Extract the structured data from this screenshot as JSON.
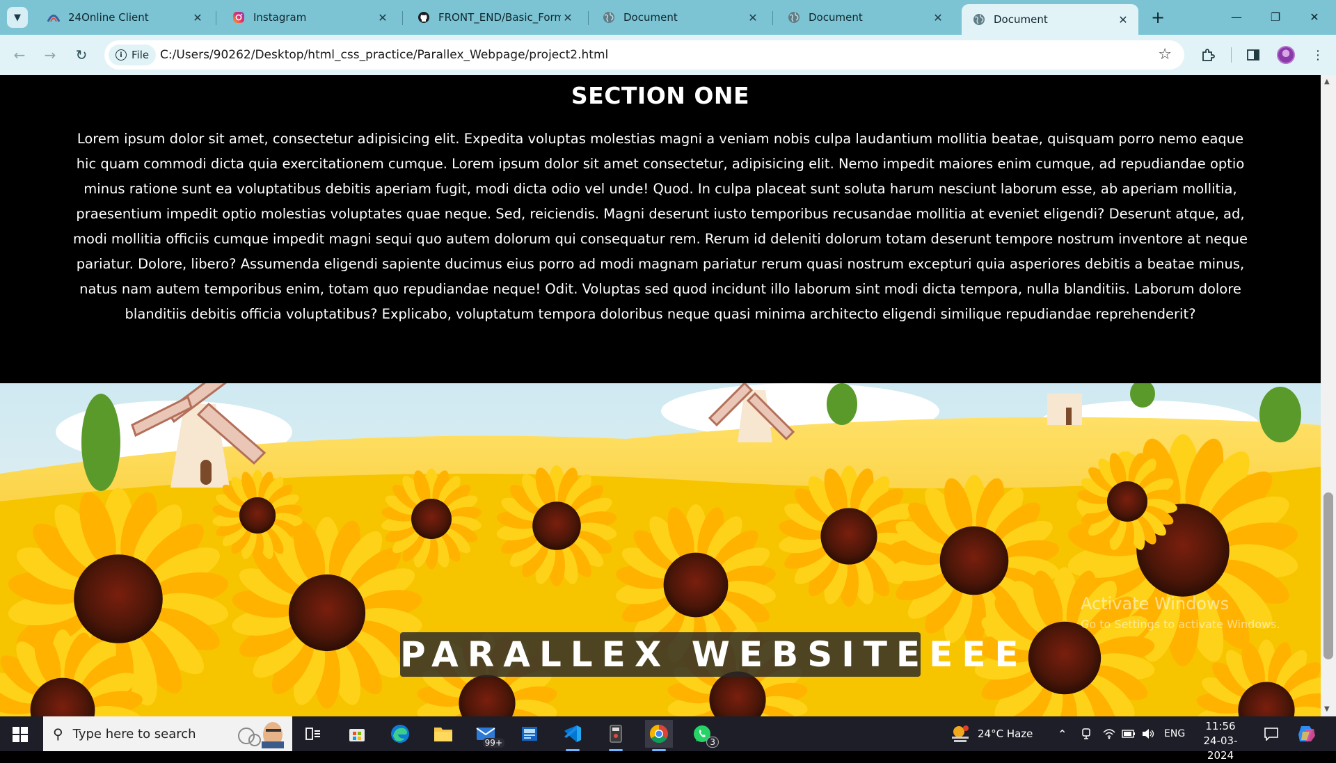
{
  "browser": {
    "tabs": [
      {
        "title": "24Online Client",
        "favicon": "24online-icon"
      },
      {
        "title": "Instagram",
        "favicon": "instagram-icon"
      },
      {
        "title": "FRONT_END/Basic_Form/",
        "favicon": "github-icon"
      },
      {
        "title": "Document",
        "favicon": "globe-icon"
      },
      {
        "title": "Document",
        "favicon": "globe-icon"
      },
      {
        "title": "Document",
        "favicon": "globe-icon",
        "active": true
      }
    ],
    "site_chip": "File",
    "url": "C:/Users/90262/Desktop/html_css_practice/Parallex_Webpage/project2.html"
  },
  "page": {
    "section_title": "SECTION ONE",
    "section_body": "Lorem ipsum dolor sit amet, consectetur adipisicing elit. Expedita voluptas molestias magni a veniam nobis culpa laudantium mollitia beatae, quisquam porro nemo eaque hic quam commodi dicta quia exercitationem cumque. Lorem ipsum dolor sit amet consectetur, adipisicing elit. Nemo impedit maiores enim cumque, ad repudiandae optio minus ratione sunt ea voluptatibus debitis aperiam fugit, modi dicta odio vel unde! Quod. In culpa placeat sunt soluta harum nesciunt laborum esse, ab aperiam mollitia, praesentium impedit optio molestias voluptates quae neque. Sed, reiciendis. Magni deserunt iusto temporibus recusandae mollitia at eveniet eligendi? Deserunt atque, ad, modi mollitia officiis cumque impedit magni sequi quo autem dolorum qui consequatur rem. Rerum id deleniti dolorum totam deserunt tempore nostrum inventore at neque pariatur. Dolore, libero? Assumenda eligendi sapiente ducimus eius porro ad modi magnam pariatur rerum quasi nostrum excepturi quia asperiores debitis a beatae minus, natus nam autem temporibus enim, totam quo repudiandae neque! Odit. Voluptas sed quod incidunt illo laborum sint modi dicta tempora, nulla blanditiis. Laborum dolore blanditiis debitis officia voluptatibus? Explicabo, voluptatum tempora doloribus neque quasi minima architecto eligendi similique repudiandae reprehenderit?",
    "hero_title": "PARALLEX WEBSITEEEE",
    "hero_image": "sunflower-field-with-windmills",
    "watermark_line1": "Activate Windows",
    "watermark_line2": "Go to Settings to activate Windows."
  },
  "taskbar": {
    "search_placeholder": "Type here to search",
    "mail_badge": "99+",
    "whatsapp_badge": "3",
    "weather": "24°C  Haze",
    "language": "ENG",
    "time": "11:56",
    "date": "24-03-2024"
  },
  "colors": {
    "tabstrip": "#7cc4d4",
    "toolbar": "#e2f3f7",
    "page_background": "#000000",
    "taskbar": "#1e1e28"
  }
}
